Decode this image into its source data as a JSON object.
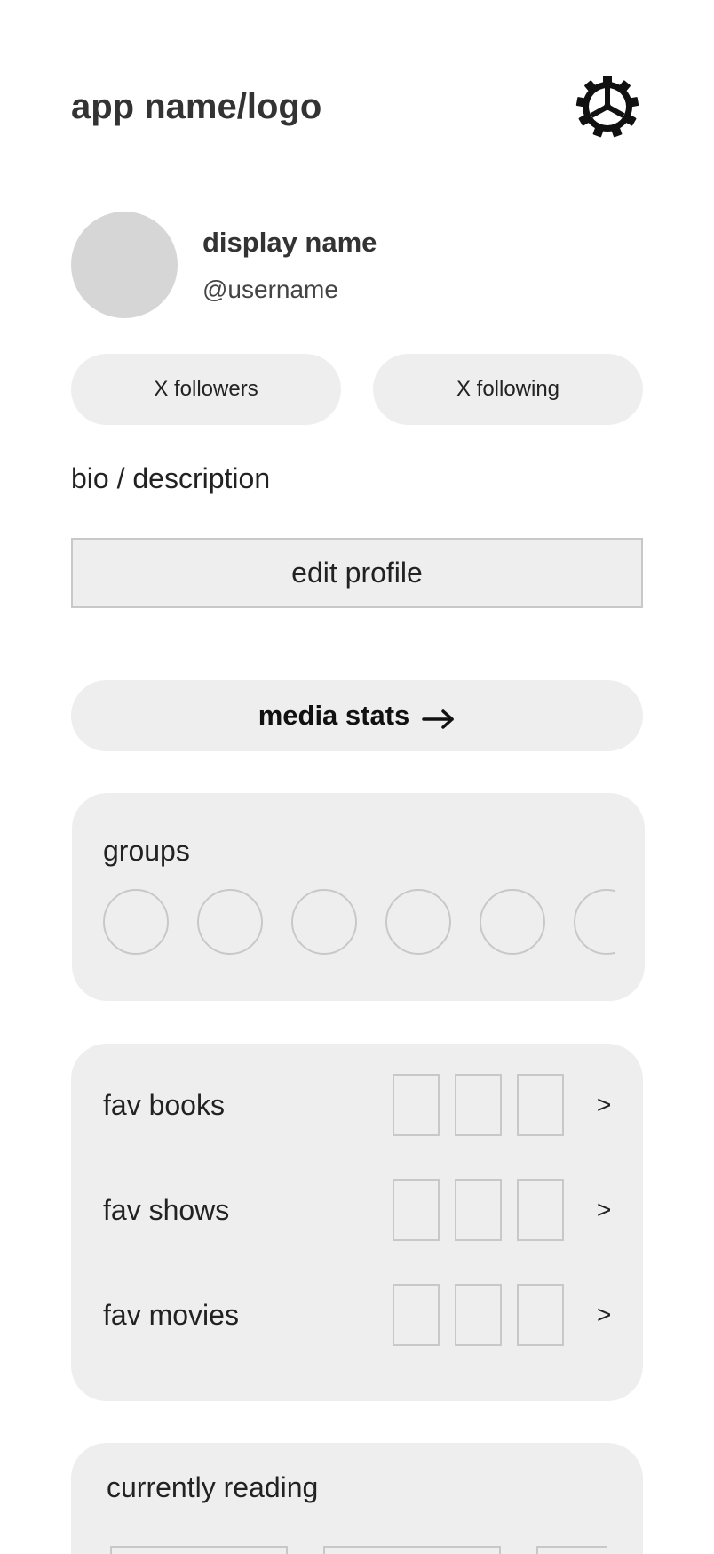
{
  "header": {
    "title": "app name/logo",
    "settings_icon": "gear-icon"
  },
  "profile": {
    "display_name": "display name",
    "username": "@username",
    "followers_label": "X followers",
    "following_label": "X following",
    "bio": "bio / description",
    "edit_label": "edit profile"
  },
  "media_stats": {
    "label": "media stats",
    "icon": "arrow-right-icon"
  },
  "groups": {
    "title": "groups",
    "visible_count": 6
  },
  "favorites": {
    "rows": [
      {
        "label": "fav books",
        "chevron": ">"
      },
      {
        "label": "fav shows",
        "chevron": ">"
      },
      {
        "label": "fav movies",
        "chevron": ">"
      }
    ]
  },
  "currently_reading": {
    "title": "currently reading"
  },
  "colors": {
    "card_bg": "#eeeeee",
    "avatar": "#d6d6d6",
    "placeholder_border": "#c8c8c8",
    "heading_text": "#333333"
  }
}
